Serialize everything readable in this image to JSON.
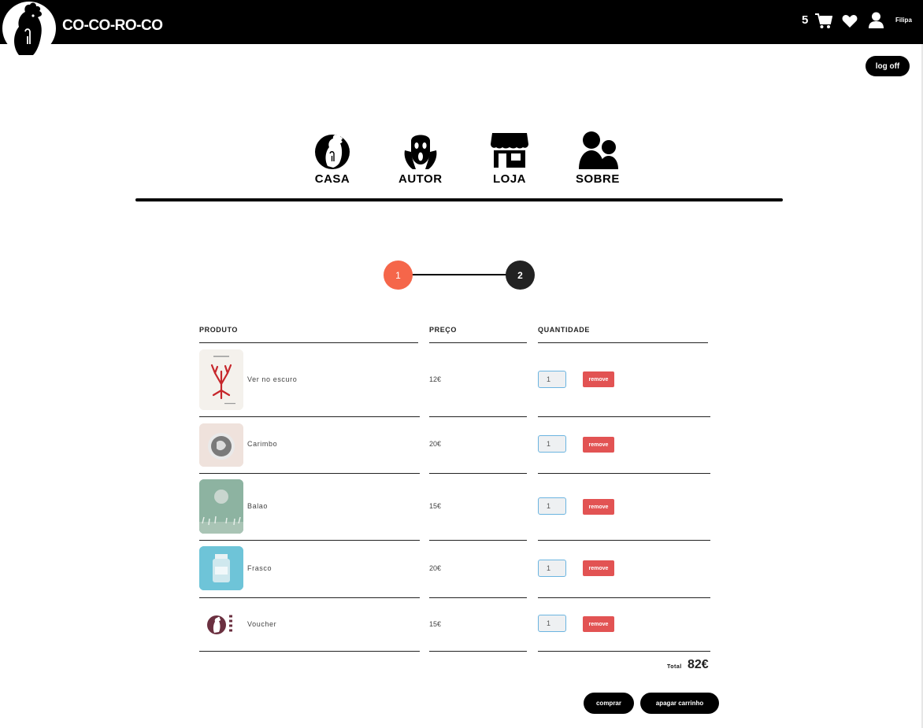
{
  "header": {
    "brand": "CO-CO-RO-CO",
    "cart_count": "5",
    "username": "Filipa",
    "logoff_label": "log off"
  },
  "nav": [
    {
      "label": "CASA",
      "icon": "rooster-icon"
    },
    {
      "label": "AUTOR",
      "icon": "scream-face-icon"
    },
    {
      "label": "LOJA",
      "icon": "shop-icon"
    },
    {
      "label": "SOBRE",
      "icon": "people-icon"
    }
  ],
  "stepper": {
    "current_step": "1",
    "next_step": "2",
    "active_color": "#f5664a",
    "inactive_color": "#222222"
  },
  "cart": {
    "headers": {
      "product": "PRODUTO",
      "price": "PREÇO",
      "quantity": "QUANTIDADE"
    },
    "remove_label": "remove",
    "items": [
      {
        "name": "Ver no escuro",
        "price": "12€",
        "quantity": "1",
        "thumb_icon": "book-cover-thumbnail"
      },
      {
        "name": "Carimbo",
        "price": "20€",
        "quantity": "1",
        "thumb_icon": "stamp-thumbnail"
      },
      {
        "name": "Balao",
        "price": "15€",
        "quantity": "1",
        "thumb_icon": "balloon-thumbnail"
      },
      {
        "name": "Frasco",
        "price": "20€",
        "quantity": "1",
        "thumb_icon": "jar-thumbnail"
      },
      {
        "name": "Voucher",
        "price": "15€",
        "quantity": "1",
        "thumb_icon": "voucher-logo-thumbnail"
      }
    ],
    "total_label": "Total",
    "total_value": "82€"
  },
  "actions": {
    "buy_label": "comprar",
    "clear_label": "apagar carrinho"
  },
  "colors": {
    "topbar": "#000000",
    "remove": "#e25353",
    "qty_border": "#6bb4e0"
  }
}
